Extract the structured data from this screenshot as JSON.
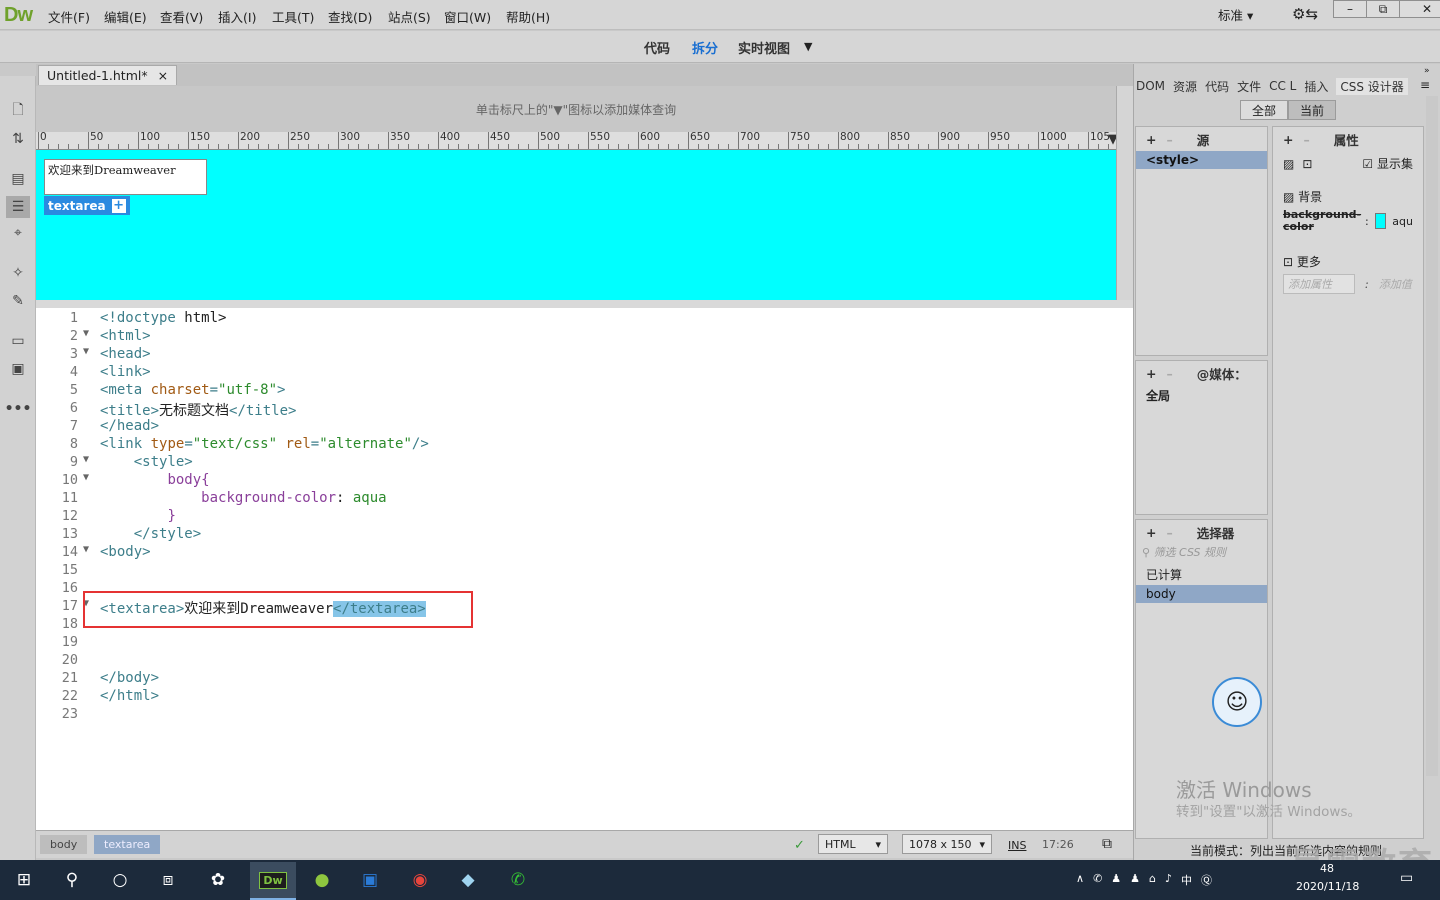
{
  "app": {
    "logo": "Dw"
  },
  "menu": [
    "文件(F)",
    "编辑(E)",
    "查看(V)",
    "插入(I)",
    "工具(T)",
    "查找(D)",
    "站点(S)",
    "窗口(W)",
    "帮助(H)"
  ],
  "layout_select": "标准",
  "window_buttons": [
    "–",
    "⧉",
    "✕"
  ],
  "view_modes": {
    "code": "代码",
    "split": "拆分",
    "live": "实时视图",
    "active": "拆分"
  },
  "document": {
    "tab": "Untitled-1.html*",
    "close": "×"
  },
  "mq_hint": "单击标尺上的\"▼\"图标以添加媒体查询",
  "ruler_labels": [
    "0",
    "50",
    "100",
    "150",
    "200",
    "250",
    "300",
    "350",
    "400",
    "450",
    "500",
    "550",
    "600",
    "650",
    "700",
    "750",
    "800",
    "850",
    "900",
    "950",
    "1000",
    "105"
  ],
  "live_view": {
    "textarea_value": "欢迎来到Dreamweaver",
    "tag_label": "textarea",
    "tag_plus": "+",
    "bg": "#00ffff"
  },
  "code": [
    {
      "n": "1",
      "fold": "",
      "t": "<!doctype html>"
    },
    {
      "n": "2",
      "fold": "▼",
      "t": "<html>"
    },
    {
      "n": "3",
      "fold": "▼",
      "t": "<head>"
    },
    {
      "n": "4",
      "fold": "",
      "t": "<link>"
    },
    {
      "n": "5",
      "fold": "",
      "t": "<meta charset=\"utf-8\">"
    },
    {
      "n": "6",
      "fold": "",
      "t": "<title>无标题文档</title>"
    },
    {
      "n": "7",
      "fold": "",
      "t": "</head>"
    },
    {
      "n": "8",
      "fold": "",
      "t": "<link type=\"text/css\" rel=\"alternate\"/>"
    },
    {
      "n": "9",
      "fold": "▼",
      "t": "    <style>"
    },
    {
      "n": "10",
      "fold": "▼",
      "t": "        body{"
    },
    {
      "n": "11",
      "fold": "",
      "t": "            background-color: aqua"
    },
    {
      "n": "12",
      "fold": "",
      "t": "        }"
    },
    {
      "n": "13",
      "fold": "",
      "t": "    </style>"
    },
    {
      "n": "14",
      "fold": "▼",
      "t": "<body>"
    },
    {
      "n": "15",
      "fold": "",
      "t": ""
    },
    {
      "n": "16",
      "fold": "",
      "t": ""
    },
    {
      "n": "17",
      "fold": "▼",
      "t": "<textarea>欢迎来到Dreamweaver</textarea>"
    },
    {
      "n": "18",
      "fold": "",
      "t": ""
    },
    {
      "n": "19",
      "fold": "",
      "t": ""
    },
    {
      "n": "20",
      "fold": "",
      "t": ""
    },
    {
      "n": "21",
      "fold": "",
      "t": "</body>"
    },
    {
      "n": "22",
      "fold": "",
      "t": "</html>"
    },
    {
      "n": "23",
      "fold": "",
      "t": ""
    }
  ],
  "status": {
    "crumbs": [
      "body",
      "textarea"
    ],
    "doc_type": "HTML",
    "window_size": "1078 x 150",
    "ins": "INS",
    "cursor": "17:26"
  },
  "right_panel": {
    "tabs": [
      "DOM",
      "资源",
      "代码",
      "文件",
      "CC L",
      "插入",
      "CSS 设计器"
    ],
    "seg": [
      "全部",
      "当前"
    ],
    "sources_title": "源",
    "source_item": "<style>",
    "media_title": "@媒体：",
    "media_item": "全局",
    "selectors_title": "选择器",
    "selector_filter": "筛选 CSS 规则",
    "computed": "已计算",
    "selector_item": "body",
    "props_title": "属性",
    "show_set": "显示集",
    "bg_section": "背景",
    "bg_prop": "background-color",
    "bg_value": "aqu",
    "more_section": "更多",
    "add_prop": "添加属性",
    "add_value": "添加值",
    "mode_text": "当前模式：列出当前所选内容的规则"
  },
  "watermark": {
    "line1": "激活 Windows",
    "line2": "转到\"设置\"以激活 Windows。"
  },
  "brand": "最需教育",
  "taskbar": {
    "ime": "中",
    "time": "48",
    "date": "2020/11/18"
  }
}
